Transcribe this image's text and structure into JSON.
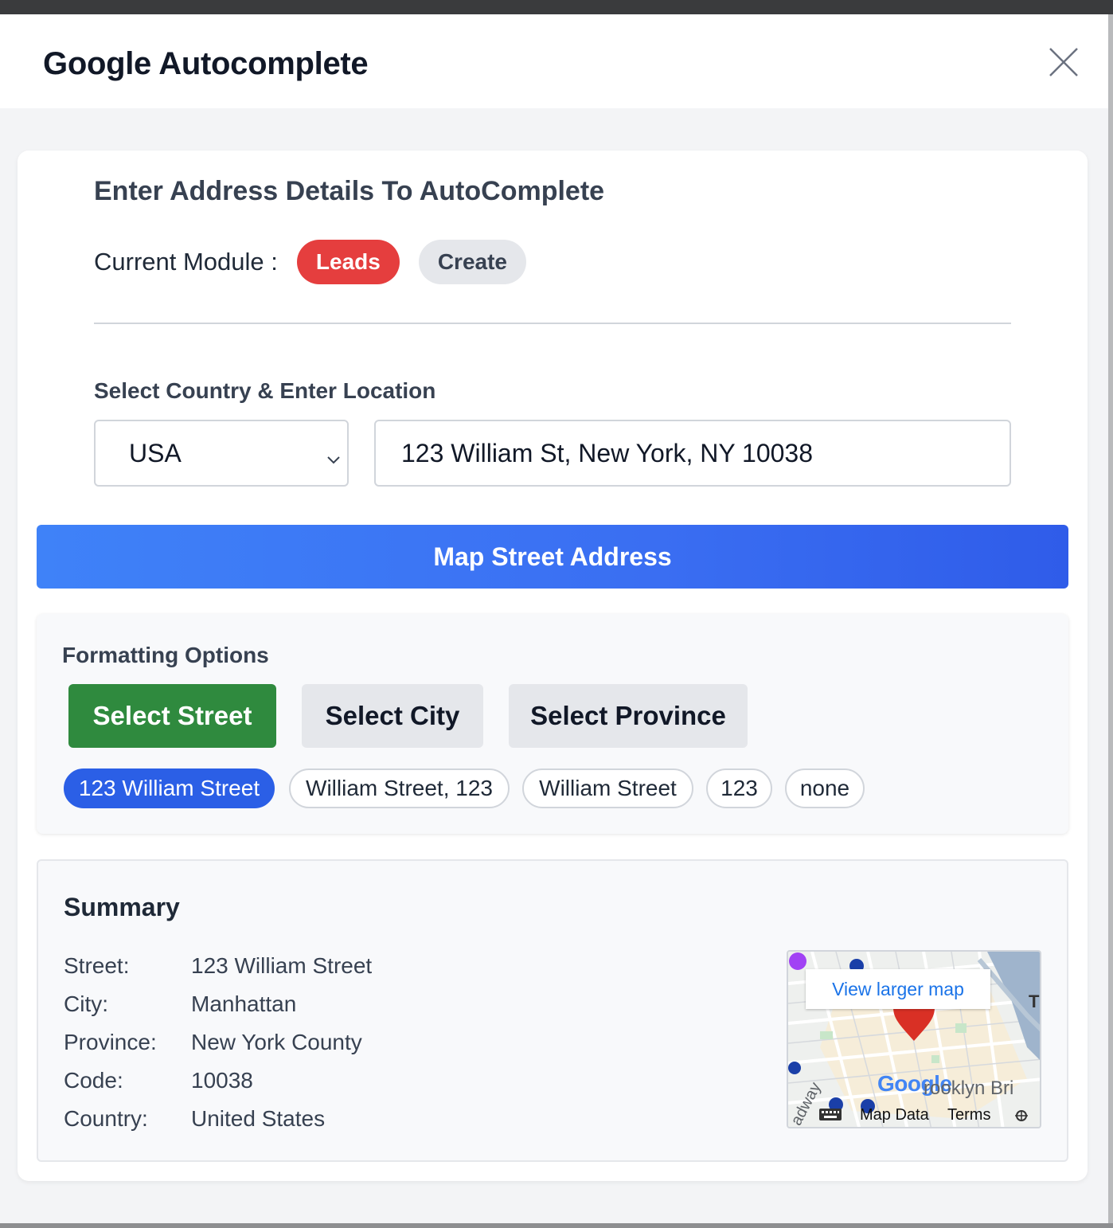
{
  "modal": {
    "title": "Google Autocomplete"
  },
  "form": {
    "section_title": "Enter Address Details To AutoComplete",
    "module_label": "Current Module :",
    "module_badges": [
      "Leads",
      "Create"
    ],
    "field_label": "Select Country & Enter Location",
    "country_selected": "USA",
    "location_value": "123 William St, New York, NY 10038",
    "map_button": "Map Street Address"
  },
  "formatting": {
    "title": "Formatting Options",
    "buttons": [
      "Select Street",
      "Select City",
      "Select Province"
    ],
    "active_button": "Select Street",
    "chips": [
      "123 William Street",
      "William Street, 123",
      "William Street",
      "123",
      "none"
    ],
    "active_chip": "123 William Street"
  },
  "summary": {
    "title": "Summary",
    "rows": [
      {
        "key": "Street:",
        "value": "123 William Street"
      },
      {
        "key": "City:",
        "value": "Manhattan"
      },
      {
        "key": "Province:",
        "value": "New York County"
      },
      {
        "key": "Code:",
        "value": "10038"
      },
      {
        "key": "Country:",
        "value": "United States"
      }
    ]
  },
  "map": {
    "view_larger": "View larger map",
    "logo": "Google",
    "place_label": "rooklyn Bri",
    "street_label": "adway",
    "map_data": "Map Data",
    "terms": "Terms",
    "edge_label": "T"
  },
  "colors": {
    "leads_badge": "#e53e3e",
    "map_button": "#3b76f4",
    "active_format": "#2f8a3e",
    "active_chip": "#2b5fe6",
    "map_pin": "#d93025"
  }
}
